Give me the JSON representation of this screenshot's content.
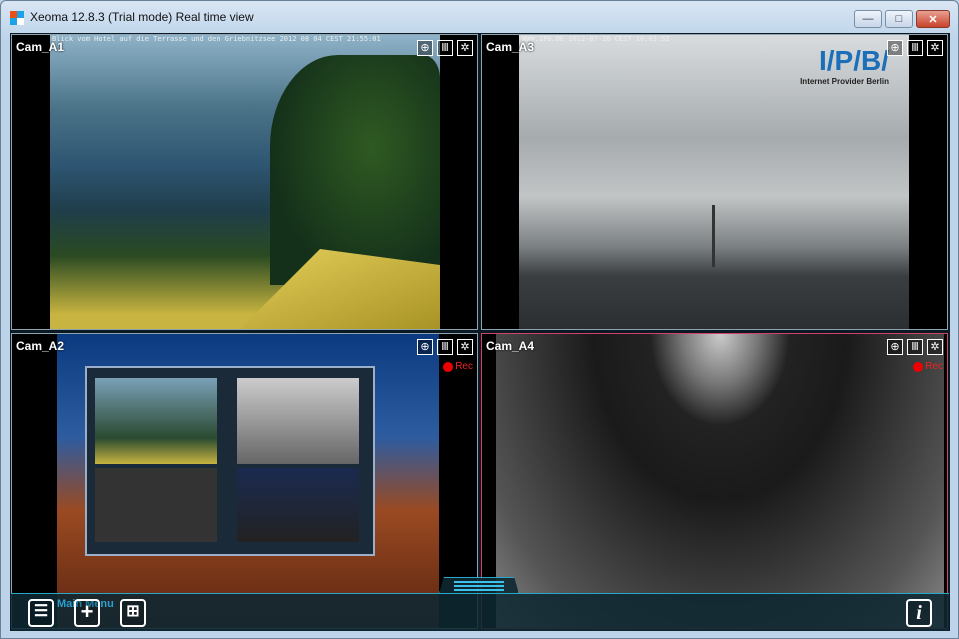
{
  "window": {
    "title": "Xeoma 12.8.3 (Trial mode) Real time view",
    "minimize": "—",
    "maximize": "□",
    "close": "✕"
  },
  "cameras": [
    {
      "id": "a1",
      "label": "Cam_A1",
      "osd": "Blick vom Hotel auf die Terrasse und den Griebnitzsee   2012 08 04 CEST 21:55:01",
      "recording": false
    },
    {
      "id": "a3",
      "label": "Cam_A3",
      "osd": "WWW.IPB.DE                                      2012-07-26 CEST 10:03:52",
      "logo": "I/P/B/",
      "logo_sub": "Internet Provider Berlin",
      "recording": false
    },
    {
      "id": "a2",
      "label": "Cam_A2",
      "recording": true,
      "rec_label": "Rec"
    },
    {
      "id": "a4",
      "label": "Cam_A4",
      "recording": true,
      "rec_label": "Rec",
      "active": true
    }
  ],
  "icons": {
    "ptz": "ptz-crosshair-icon",
    "archive": "archive-icon",
    "settings": "gear-icon"
  },
  "bottom": {
    "main_menu": "Main Menu",
    "list_icon": "list-icon",
    "add_icon": "plus-icon",
    "layout_icon": "grid-layout-icon",
    "info": "i"
  },
  "colors": {
    "accent": "#2aa6c8",
    "active_border": "#d2416a",
    "rec": "#e00000"
  }
}
